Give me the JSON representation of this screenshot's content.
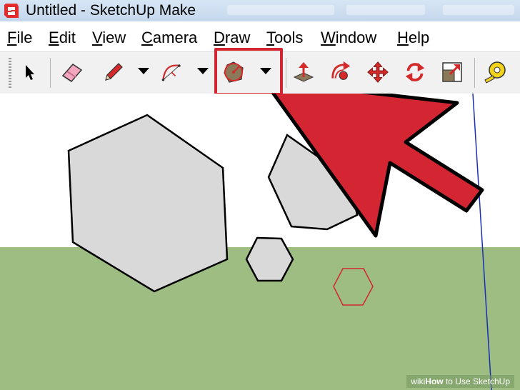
{
  "window": {
    "title": "Untitled - SketchUp Make"
  },
  "menu": {
    "items": [
      {
        "label": "File",
        "underline": "F",
        "rest": "ile"
      },
      {
        "label": "Edit",
        "underline": "E",
        "rest": "dit"
      },
      {
        "label": "View",
        "underline": "V",
        "rest": "iew"
      },
      {
        "label": "Camera",
        "underline": "C",
        "rest": "amera"
      },
      {
        "label": "Draw",
        "underline": "D",
        "rest": "raw"
      },
      {
        "label": "Tools",
        "underline": "T",
        "rest": "ools"
      },
      {
        "label": "Window",
        "underline": "W",
        "rest": "indow"
      },
      {
        "label": "Help",
        "underline": "H",
        "rest": "elp"
      }
    ]
  },
  "toolbar": {
    "tools": [
      "select-icon",
      "eraser-icon",
      "pencil-icon",
      "arc-icon",
      "polygon-icon",
      "push-pull-icon",
      "follow-me-icon",
      "move-icon",
      "rotate-icon",
      "scale-icon",
      "tape-measure-icon"
    ],
    "selected_tool": "polygon-icon"
  },
  "colors": {
    "sky": "#ffffff",
    "ground": "#9dbd82",
    "highlight": "#d32632",
    "arrow": "#d32632",
    "shape_fill": "#d9d9d9"
  },
  "watermark": {
    "wiki": "wiki",
    "how": "How",
    "rest": " to Use SketchUp"
  }
}
